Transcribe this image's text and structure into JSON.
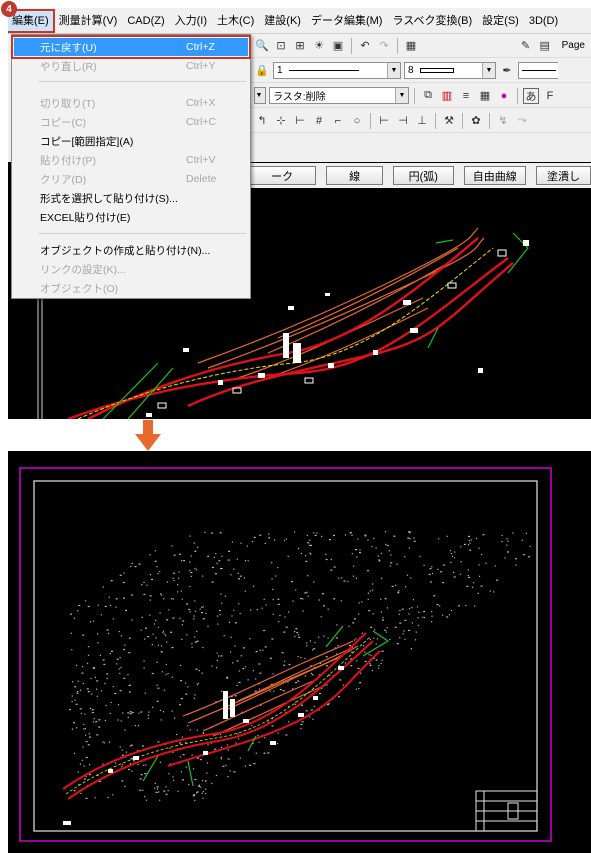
{
  "step_badge": "4",
  "menubar": {
    "items": [
      {
        "label": "編集(E)"
      },
      {
        "label": "測量計算(V)"
      },
      {
        "label": "CAD(Z)"
      },
      {
        "label": "入力(I)"
      },
      {
        "label": "土木(C)"
      },
      {
        "label": "建設(K)"
      },
      {
        "label": "データ編集(M)"
      },
      {
        "label": "ラスベク変換(B)"
      },
      {
        "label": "設定(S)"
      },
      {
        "label": "3D(D)"
      }
    ]
  },
  "edit_menu": {
    "items": [
      {
        "label": "元に戻す(U)",
        "shortcut": "Ctrl+Z",
        "state": "selected"
      },
      {
        "label": "やり直し(R)",
        "shortcut": "Ctrl+Y",
        "state": "disabled"
      },
      {
        "label": "切り取り(T)",
        "shortcut": "Ctrl+X",
        "state": "disabled"
      },
      {
        "label": "コピー(C)",
        "shortcut": "Ctrl+C",
        "state": "disabled"
      },
      {
        "label": "コピー[範囲指定](A)",
        "shortcut": "",
        "state": "enabled"
      },
      {
        "label": "貼り付け(P)",
        "shortcut": "Ctrl+V",
        "state": "disabled"
      },
      {
        "label": "クリア(D)",
        "shortcut": "Delete",
        "state": "disabled"
      },
      {
        "label": "形式を選択して貼り付け(S)...",
        "shortcut": "",
        "state": "enabled"
      },
      {
        "label": "EXCEL貼り付け(E)",
        "shortcut": "",
        "state": "enabled"
      },
      {
        "label": "オブジェクトの作成と貼り付け(N)...",
        "shortcut": "",
        "state": "enabled"
      },
      {
        "label": "リンクの設定(K)...",
        "shortcut": "",
        "state": "disabled"
      },
      {
        "label": "オブジェクト(O)",
        "shortcut": "",
        "state": "disabled"
      }
    ]
  },
  "toolbar": {
    "page_label": "Page",
    "line_width_value": "1",
    "line_width_value_2": "8",
    "raster_combo": "ラスタ:削除"
  },
  "command_buttons": [
    {
      "label": "ーク"
    },
    {
      "label": "線"
    },
    {
      "label": "円(弧)"
    },
    {
      "label": "自由曲線"
    },
    {
      "label": "塗潰し"
    }
  ],
  "colors": {
    "accent_red": "#c0392b",
    "selection_blue": "#3399ff",
    "arrow_orange": "#e8692d",
    "frame_magenta": "#d000d0"
  }
}
